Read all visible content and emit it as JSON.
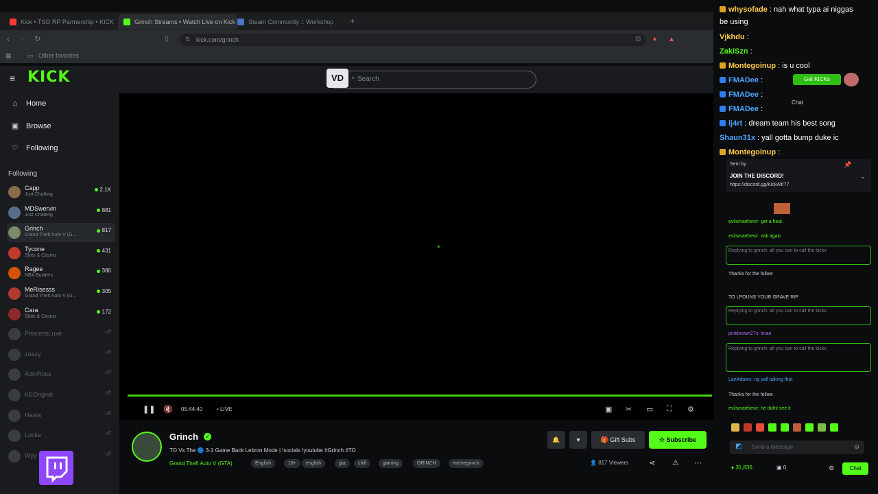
{
  "browser": {
    "tabs": [
      {
        "label": "Kick • TSO RP Partnership • KICK",
        "color": "#ff3b30"
      },
      {
        "label": "Grinch Streams • Watch Live on Kick",
        "color": "#53fc18"
      },
      {
        "label": "Steam Community :: Workshop",
        "color": "#4a78c2"
      }
    ],
    "url": "kick.com/grinch",
    "bookmark": "Other favorites"
  },
  "header": {
    "logo": "KICK",
    "search_placeholder": "Search",
    "search_badge": "VD"
  },
  "sidebar": {
    "nav": [
      {
        "label": "Home",
        "icon": "home-icon",
        "glyph": "⌂"
      },
      {
        "label": "Browse",
        "icon": "browse-icon",
        "glyph": "▣"
      },
      {
        "label": "Following",
        "icon": "heart-icon",
        "glyph": "♡"
      }
    ],
    "following_title": "Following",
    "channels": [
      {
        "name": "Capp",
        "sub": "Just Chatting",
        "viewers": "2.1K",
        "color": "#8a6b4a",
        "live": true
      },
      {
        "name": "MDSwervin",
        "sub": "Just Chatting",
        "viewers": "881",
        "color": "#5a6e8a",
        "live": true
      },
      {
        "name": "Grinch",
        "sub": "Grand Theft Auto V (G...",
        "viewers": "817",
        "color": "#7a8a6a",
        "live": true,
        "selected": true
      },
      {
        "name": "Tycone",
        "sub": "Slots & Casino",
        "viewers": "431",
        "color": "#c0392b",
        "live": true
      },
      {
        "name": "Ragee",
        "sub": "NBA Builders",
        "viewers": "380",
        "color": "#d35400",
        "live": true
      },
      {
        "name": "MeRisesss",
        "sub": "Grand Theft Auto V (G...",
        "viewers": "305",
        "color": "#b03a2e",
        "live": true
      },
      {
        "name": "Cara",
        "sub": "Slots & Casino",
        "viewers": "172",
        "color": "#8e2a2a",
        "live": true
      },
      {
        "name": "PrincessLuxe",
        "sub": "",
        "viewers": "off",
        "color": "#3a3d40",
        "live": false
      },
      {
        "name": "zoazy",
        "sub": "",
        "viewers": "off",
        "color": "#3a3d40",
        "live": false
      },
      {
        "name": "AdinRoss",
        "sub": "",
        "viewers": "off",
        "color": "#3a3d40",
        "live": false
      },
      {
        "name": "KEOrignal",
        "sub": "",
        "viewers": "off",
        "color": "#3a3d40",
        "live": false
      },
      {
        "name": "Hasta",
        "sub": "",
        "viewers": "off",
        "color": "#3a3d40",
        "live": false
      },
      {
        "name": "Locke",
        "sub": "",
        "viewers": "off",
        "color": "#3a3d40",
        "live": false
      },
      {
        "name": "Wyy",
        "sub": "",
        "viewers": "off",
        "color": "#3a3d40",
        "live": false
      }
    ]
  },
  "player": {
    "time": "05:44:40",
    "live_label": "LIVE",
    "progress": 1.0
  },
  "stream": {
    "streamer": "Grinch",
    "title": "TO Vs The 🔵 3-1 Game Back Lebron Mode | !socials !youtube #Grinch #TO",
    "category": "Grand Theft Auto V (GTA)",
    "tags": [
      "English",
      "18+",
      "english",
      "gta",
      "chill",
      "gaming",
      "GRINCH",
      "memegrinch"
    ],
    "gift_label": "Gift Subs",
    "sub_label": "Subscribe",
    "viewers": "817 Viewers"
  },
  "chat": {
    "messages": [
      {
        "user": "whysofade",
        "text": "nah what typa ai niggas",
        "color": "#ffcc4d",
        "badge": "#e0a020"
      },
      {
        "user": "",
        "text": "be using",
        "color": "#ffffff",
        "badge": ""
      },
      {
        "user": "Vjkhdu",
        "text": "",
        "color": "#ffcc4d",
        "badge": ""
      },
      {
        "user": "ZakiSzn",
        "text": "",
        "color": "#53fc18",
        "badge": ""
      },
      {
        "user": "Montegoinup",
        "text": "is u cool",
        "color": "#ffcc4d",
        "badge": "#e0a020"
      },
      {
        "user": "FMADee",
        "text": "",
        "color": "#4aa3ff",
        "badge": "#2d7ff0"
      },
      {
        "user": "FMADee",
        "text": "",
        "color": "#4aa3ff",
        "badge": "#2d7ff0"
      },
      {
        "user": "FMADee",
        "text": "",
        "color": "#4aa3ff",
        "badge": "#2d7ff0"
      },
      {
        "user": "lj4rt",
        "text": "dream team his best song",
        "color": "#4aa3ff",
        "badge": "#2d7ff0"
      },
      {
        "user": "Shaun31x",
        "text": "yall gotta bump duke ic",
        "color": "#4aa3ff",
        "badge": ""
      },
      {
        "user": "Montegoinup",
        "text": "",
        "color": "#ffcc4d",
        "badge": "#e0a020"
      }
    ],
    "overlay_buttons": [
      "Get KICKs",
      "Chat"
    ],
    "pinned": {
      "label": "Sent by",
      "text": "JOIN THE DISCORD!",
      "link": "https://discord.gg/KickAlt/77"
    },
    "small_messages": [
      {
        "text": "evilsmarthevir: get a heal",
        "color": "#53fc18"
      },
      {
        "text": "evilsmarthevir: ask again",
        "color": "#53fc18"
      },
      {
        "text": "Replying to grinch: all you can to call the kicks",
        "color": "#7e858b"
      },
      {
        "text": "Thanks for the follow",
        "color": "#cfd3d6"
      },
      {
        "text": "TO LPOUNS YOUR GRAVE RIP",
        "color": "#cfd3d6"
      },
      {
        "text": "Replying to grinch: all you can to call the kicks",
        "color": "#7e858b"
      },
      {
        "text": "pinkbrown27s: lmao",
        "color": "#b26bff"
      },
      {
        "text": "Replying to grinch: all you can to call the kicks",
        "color": "#7e858b"
      },
      {
        "text": "LanAdams: ng yall talking that",
        "color": "#4aa3ff"
      },
      {
        "text": "Thanks for the follow",
        "color": "#cfd3d6"
      },
      {
        "text": "evilsmarthevir: he didnt see it",
        "color": "#53fc18"
      }
    ],
    "input_placeholder": "Send a message",
    "kicks": "31,836",
    "count": "0",
    "chat_button": "Chat"
  }
}
